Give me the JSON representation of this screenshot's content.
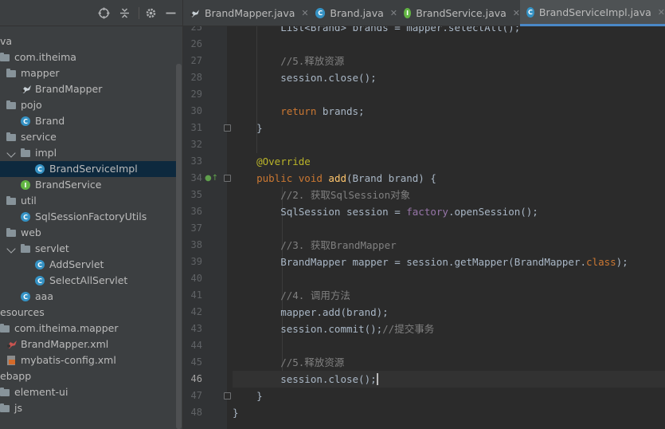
{
  "toolbar": {
    "icons": [
      "target-icon",
      "collapse-icon",
      "gear-icon",
      "minimize-icon"
    ]
  },
  "tree": [
    {
      "label": "va",
      "icon": "none",
      "arrow": false
    },
    {
      "label": "com.itheima",
      "icon": "folder",
      "arrow": false
    },
    {
      "label": "mapper",
      "icon": "folder",
      "arrow": false
    },
    {
      "label": "BrandMapper",
      "icon": "mybatis",
      "arrow": false
    },
    {
      "label": "pojo",
      "icon": "folder",
      "arrow": false
    },
    {
      "label": "Brand",
      "icon": "class",
      "arrow": false
    },
    {
      "label": "service",
      "icon": "folder",
      "arrow": false
    },
    {
      "label": "impl",
      "icon": "folder",
      "arrow": true
    },
    {
      "label": "BrandServiceImpl",
      "icon": "class",
      "arrow": false,
      "selected": true
    },
    {
      "label": "BrandService",
      "icon": "interface",
      "arrow": false
    },
    {
      "label": "util",
      "icon": "folder",
      "arrow": false
    },
    {
      "label": "SqlSessionFactoryUtils",
      "icon": "class",
      "arrow": false
    },
    {
      "label": "web",
      "icon": "folder",
      "arrow": false
    },
    {
      "label": "servlet",
      "icon": "folder",
      "arrow": true
    },
    {
      "label": "AddServlet",
      "icon": "class",
      "arrow": false
    },
    {
      "label": "SelectAllServlet",
      "icon": "class",
      "arrow": false
    },
    {
      "label": "aaa",
      "icon": "class",
      "arrow": false
    },
    {
      "label": "esources",
      "icon": "none",
      "arrow": false
    },
    {
      "label": "com.itheima.mapper",
      "icon": "folder",
      "arrow": false
    },
    {
      "label": "BrandMapper.xml",
      "icon": "mybatis-xml",
      "arrow": false
    },
    {
      "label": "mybatis-config.xml",
      "icon": "xml",
      "arrow": false
    },
    {
      "label": "ebapp",
      "icon": "none",
      "arrow": false
    },
    {
      "label": "element-ui",
      "icon": "folder",
      "arrow": false
    },
    {
      "label": "js",
      "icon": "folder",
      "arrow": false
    }
  ],
  "tabs": [
    {
      "label": "BrandMapper.java",
      "icon": "mybatis",
      "active": false
    },
    {
      "label": "Brand.java",
      "icon": "class",
      "active": false
    },
    {
      "label": "BrandService.java",
      "icon": "interface",
      "active": false
    },
    {
      "label": "BrandServiceImpl.java",
      "icon": "class",
      "active": true
    }
  ],
  "editor": {
    "current_line": 46,
    "lines": [
      {
        "num": "25",
        "code": [
          [
            "t",
            "        List<Brand> brands = mapper.selectAll();"
          ]
        ]
      },
      {
        "num": "26",
        "code": []
      },
      {
        "num": "27",
        "code": [
          [
            "c",
            "        //5.释放资源"
          ]
        ]
      },
      {
        "num": "28",
        "code": [
          [
            "t",
            "        session.close();"
          ]
        ]
      },
      {
        "num": "29",
        "code": []
      },
      {
        "num": "30",
        "code": [
          [
            "k",
            "        return "
          ],
          [
            "t",
            "brands;"
          ]
        ]
      },
      {
        "num": "31",
        "code": [
          [
            "t",
            "    }"
          ]
        ]
      },
      {
        "num": "32",
        "code": []
      },
      {
        "num": "33",
        "code": [
          [
            "a",
            "    @Override"
          ]
        ]
      },
      {
        "num": "34",
        "code": [
          [
            "k",
            "    public void "
          ],
          [
            "f",
            "add"
          ],
          [
            "t",
            "(Brand brand) {"
          ]
        ]
      },
      {
        "num": "35",
        "code": [
          [
            "c",
            "        //2. 获取SqlSession对象"
          ]
        ]
      },
      {
        "num": "36",
        "code": [
          [
            "t",
            "        SqlSession session = "
          ],
          [
            "v",
            "factory"
          ],
          [
            "t",
            ".openSession();"
          ]
        ]
      },
      {
        "num": "37",
        "code": []
      },
      {
        "num": "38",
        "code": [
          [
            "c",
            "        //3. 获取BrandMapper"
          ]
        ]
      },
      {
        "num": "39",
        "code": [
          [
            "t",
            "        BrandMapper mapper = session.getMapper(BrandMapper."
          ],
          [
            "k",
            "class"
          ],
          [
            "t",
            ");"
          ]
        ]
      },
      {
        "num": "40",
        "code": []
      },
      {
        "num": "41",
        "code": [
          [
            "c",
            "        //4. 调用方法"
          ]
        ]
      },
      {
        "num": "42",
        "code": [
          [
            "t",
            "        mapper.add(brand);"
          ]
        ]
      },
      {
        "num": "43",
        "code": [
          [
            "t",
            "        session.commit();"
          ],
          [
            "c",
            "//提交事务"
          ]
        ]
      },
      {
        "num": "44",
        "code": []
      },
      {
        "num": "45",
        "code": [
          [
            "c",
            "        //5.释放资源"
          ]
        ]
      },
      {
        "num": "46",
        "code": [
          [
            "t",
            "        session.close();"
          ]
        ]
      },
      {
        "num": "47",
        "code": [
          [
            "t",
            "    }"
          ]
        ]
      },
      {
        "num": "48",
        "code": [
          [
            "t",
            "}"
          ]
        ]
      }
    ]
  }
}
